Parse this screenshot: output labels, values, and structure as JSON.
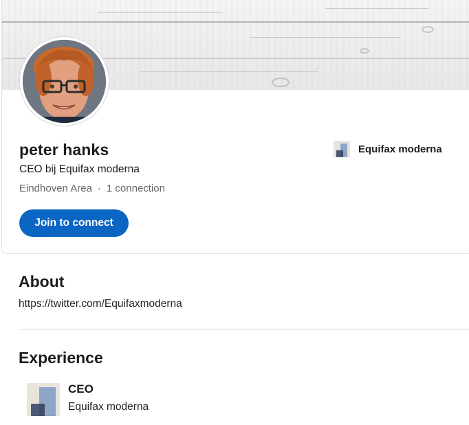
{
  "profile": {
    "name": "peter hanks",
    "headline": "CEO bij Equifax moderna",
    "location": "Eindhoven Area",
    "separator": "·",
    "connections": "1 connection",
    "join_label": "Join to connect",
    "current_company": "Equifax moderna"
  },
  "about": {
    "title": "About",
    "text": "https://twitter.com/Equifaxmoderna"
  },
  "experience": {
    "title": "Experience",
    "items": [
      {
        "role": "CEO",
        "company": "Equifax moderna"
      }
    ]
  },
  "icons": {
    "avatar": "profile-photo",
    "company_logo": "company-logo-placeholder"
  },
  "colors": {
    "primary": "#0a66c2",
    "logo_light": "#e8e4dc",
    "logo_mid": "#8da5c8",
    "logo_dark": "#4a5a76"
  }
}
